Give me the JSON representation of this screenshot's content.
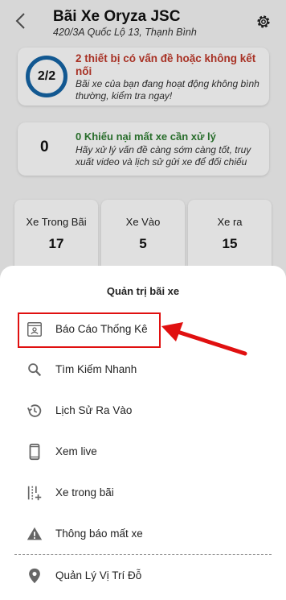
{
  "header": {
    "title": "Bãi Xe Oryza JSC",
    "address": "420/3A Quốc Lộ 13, Thạnh Bình"
  },
  "alert_card": {
    "count": "2/2",
    "title": "2 thiết bị có vấn đề hoặc không kết nối",
    "description": "Bãi xe của bạn đang hoạt động không bình thường, kiểm tra ngay!"
  },
  "complaint_card": {
    "count": "0",
    "title": "0 Khiếu nại mất xe cần xử lý",
    "description": "Hãy xử lý vấn đề càng sớm càng tốt, truy xuất video và lịch sử gửi xe để đối chiếu"
  },
  "stats": [
    {
      "label": "Xe Trong Bãi",
      "value": "17"
    },
    {
      "label": "Xe Vào",
      "value": "5"
    },
    {
      "label": "Xe ra",
      "value": "15"
    }
  ],
  "sheet": {
    "title": "Quản trị bãi xe",
    "items": [
      {
        "label": "Báo Cáo Thống Kê",
        "icon": "report-icon"
      },
      {
        "label": "Tìm Kiếm Nhanh",
        "icon": "search-icon"
      },
      {
        "label": "Lịch Sử Ra Vào",
        "icon": "history-icon"
      },
      {
        "label": "Xem live",
        "icon": "phone-icon"
      },
      {
        "label": "Xe trong bãi",
        "icon": "vehicles-list-icon"
      },
      {
        "label": "Thông báo mất xe",
        "icon": "warning-icon"
      },
      {
        "label": "Quản Lý Vị Trí Đỗ",
        "icon": "location-pin-icon"
      }
    ]
  },
  "colors": {
    "accent_red": "#c0392b",
    "accent_green": "#2e7d32",
    "ring_blue": "#1565a6",
    "highlight_red": "#e01010"
  }
}
